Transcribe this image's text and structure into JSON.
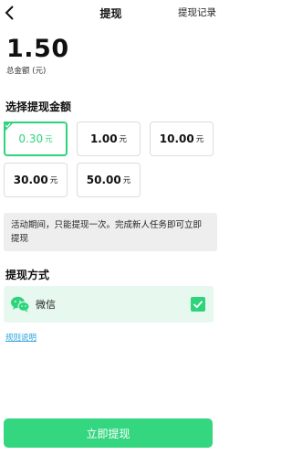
{
  "header": {
    "title": "提现",
    "records_label": "提现记录"
  },
  "balance": {
    "amount": "1.50",
    "label": "总金额 (元)"
  },
  "amount_section": {
    "title": "选择提现金额",
    "options": [
      {
        "value": "0.30",
        "unit": "元",
        "selected": true
      },
      {
        "value": "1.00",
        "unit": "元",
        "selected": false
      },
      {
        "value": "10.00",
        "unit": "元",
        "selected": false
      },
      {
        "value": "30.00",
        "unit": "元",
        "selected": false
      },
      {
        "value": "50.00",
        "unit": "元",
        "selected": false
      }
    ]
  },
  "notice": "活动期间，只能提现一次。完成新人任务即可立即提现",
  "method_section": {
    "title": "提现方式",
    "method_label": "微信",
    "checked": true
  },
  "rules_link": "规则说明",
  "submit_label": "立即提现",
  "colors": {
    "accent": "#2ed47c",
    "button": "#35d680",
    "link": "#2ea3e0",
    "method_bg": "#e7f8ef"
  }
}
